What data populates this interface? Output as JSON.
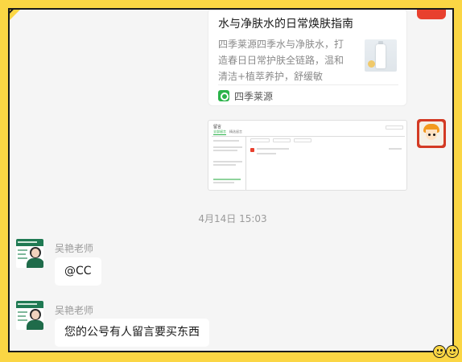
{
  "link_card": {
    "title": "水与净肤水的日常焕肤指南",
    "description": "四季莱源四季水与净肤水，打造春日日常护肤全链路，温和清洁+植萃养护，舒缓敏肌、…",
    "source": "四季莱源",
    "source_icon": "mini-program-icon"
  },
  "screenshot_message": {
    "header": "留言",
    "tabs": [
      "全部留言",
      "精选留言"
    ]
  },
  "timestamp": "4月14日 15:03",
  "messages": [
    {
      "sender": "吴艳老师",
      "text": "@CC"
    },
    {
      "sender": "吴艳老师",
      "text": "您的公号有人留言要买东西"
    }
  ],
  "colors": {
    "background_yellow": "#fbd644",
    "chat_background": "#f5f5f5",
    "bubble": "#ffffff",
    "accent_green": "#2bb34a"
  }
}
